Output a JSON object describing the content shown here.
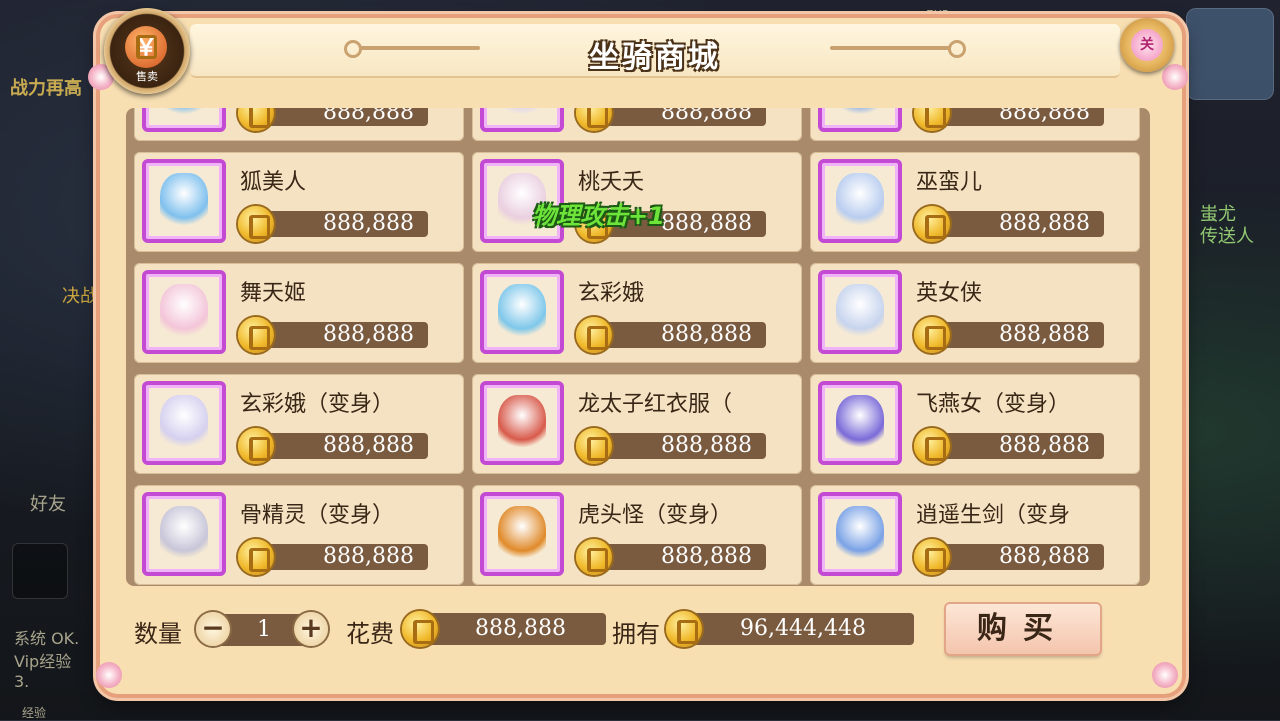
{
  "panel": {
    "title": "坐骑商城",
    "sell_button_label": "售卖",
    "sell_button_glyph": "￥",
    "close_button_label": "关"
  },
  "items": [
    {
      "name": "",
      "price": "888,888",
      "color": "#8fc4e8",
      "partial": true
    },
    {
      "name": "",
      "price": "888,888",
      "color": "#e0d7ef",
      "partial": true
    },
    {
      "name": "",
      "price": "888,888",
      "color": "#9ab8e5",
      "partial": true
    },
    {
      "name": "狐美人",
      "price": "888,888",
      "color": "#7fc0ee"
    },
    {
      "name": "桃夭夭",
      "price": "888,888",
      "color": "#eacfe0"
    },
    {
      "name": "巫蛮儿",
      "price": "888,888",
      "color": "#b9cdf0"
    },
    {
      "name": "舞天姬",
      "price": "888,888",
      "color": "#f3c5d8"
    },
    {
      "name": "玄彩娥",
      "price": "888,888",
      "color": "#7ec7ea"
    },
    {
      "name": "英女侠",
      "price": "888,888",
      "color": "#c7d4ee"
    },
    {
      "name": "玄彩娥（变身）",
      "price": "888,888",
      "color": "#d5d0ef"
    },
    {
      "name": "龙太子红衣服（",
      "price": "888,888",
      "color": "#d85a4b"
    },
    {
      "name": "飞燕女（变身）",
      "price": "888,888",
      "color": "#7a6ad8"
    },
    {
      "name": "骨精灵（变身）",
      "price": "888,888",
      "color": "#c8c6d8"
    },
    {
      "name": "虎头怪（变身）",
      "price": "888,888",
      "color": "#e08a2a"
    },
    {
      "name": "逍遥生剑（变身",
      "price": "888,888",
      "color": "#7aa2e6"
    }
  ],
  "float_text": "物理攻击+1",
  "purchase": {
    "quantity_label": "数量",
    "quantity": "1",
    "minus": "−",
    "plus": "+",
    "cost_label": "花费",
    "cost": "888,888",
    "owned_label": "拥有",
    "owned": "96,444,448",
    "buy_label": "购买"
  },
  "background": {
    "left_banner": "战力再高",
    "left_text2": "决战",
    "friends": "好友",
    "chat_line1": "系统 OK.",
    "chat_line2": "Vip经验",
    "chat_line3": "3.",
    "exp_label": "经验",
    "exp_badge": "EXP",
    "right_text1": "蚩尤",
    "right_text2": "传送人"
  }
}
